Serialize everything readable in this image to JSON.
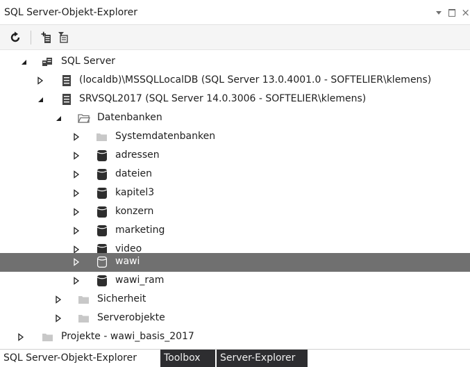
{
  "window": {
    "title": "SQL Server-Objekt-Explorer"
  },
  "toolbar": {
    "buttons": [
      "refresh-icon",
      "add-server-icon",
      "filter-icon"
    ]
  },
  "tree": {
    "root": {
      "label": "SQL Server",
      "expanded": true
    },
    "servers": [
      {
        "label": "(localdb)\\MSSQLLocalDB (SQL Server 13.0.4001.0 - SOFTELIER\\klemens)",
        "expanded": false
      },
      {
        "label": "SRVSQL2017 (SQL Server 14.0.3006 - SOFTELIER\\klemens)",
        "expanded": true
      }
    ],
    "databases_folder": {
      "label": "Datenbanken",
      "expanded": true
    },
    "system_folder": {
      "label": "Systemdatenbanken"
    },
    "databases": [
      {
        "label": "adressen"
      },
      {
        "label": "dateien"
      },
      {
        "label": "kapitel3"
      },
      {
        "label": "konzern"
      },
      {
        "label": "marketing"
      },
      {
        "label": "video"
      },
      {
        "label": "wawi",
        "selected": true
      },
      {
        "label": "wawi_ram"
      }
    ],
    "security_folder": {
      "label": "Sicherheit"
    },
    "serverobjects_folder": {
      "label": "Serverobjekte"
    },
    "projects": {
      "label": "Projekte - wawi_basis_2017"
    }
  },
  "tabs": [
    {
      "label": "SQL Server-Objekt-Explorer",
      "active": true
    },
    {
      "label": "Toolbox",
      "active": false
    },
    {
      "label": "Server-Explorer",
      "active": false
    }
  ],
  "colors": {
    "selection": "#707070",
    "tab_inactive_bg": "#2d2d30",
    "toolbar_bg": "#f5f5f5"
  }
}
